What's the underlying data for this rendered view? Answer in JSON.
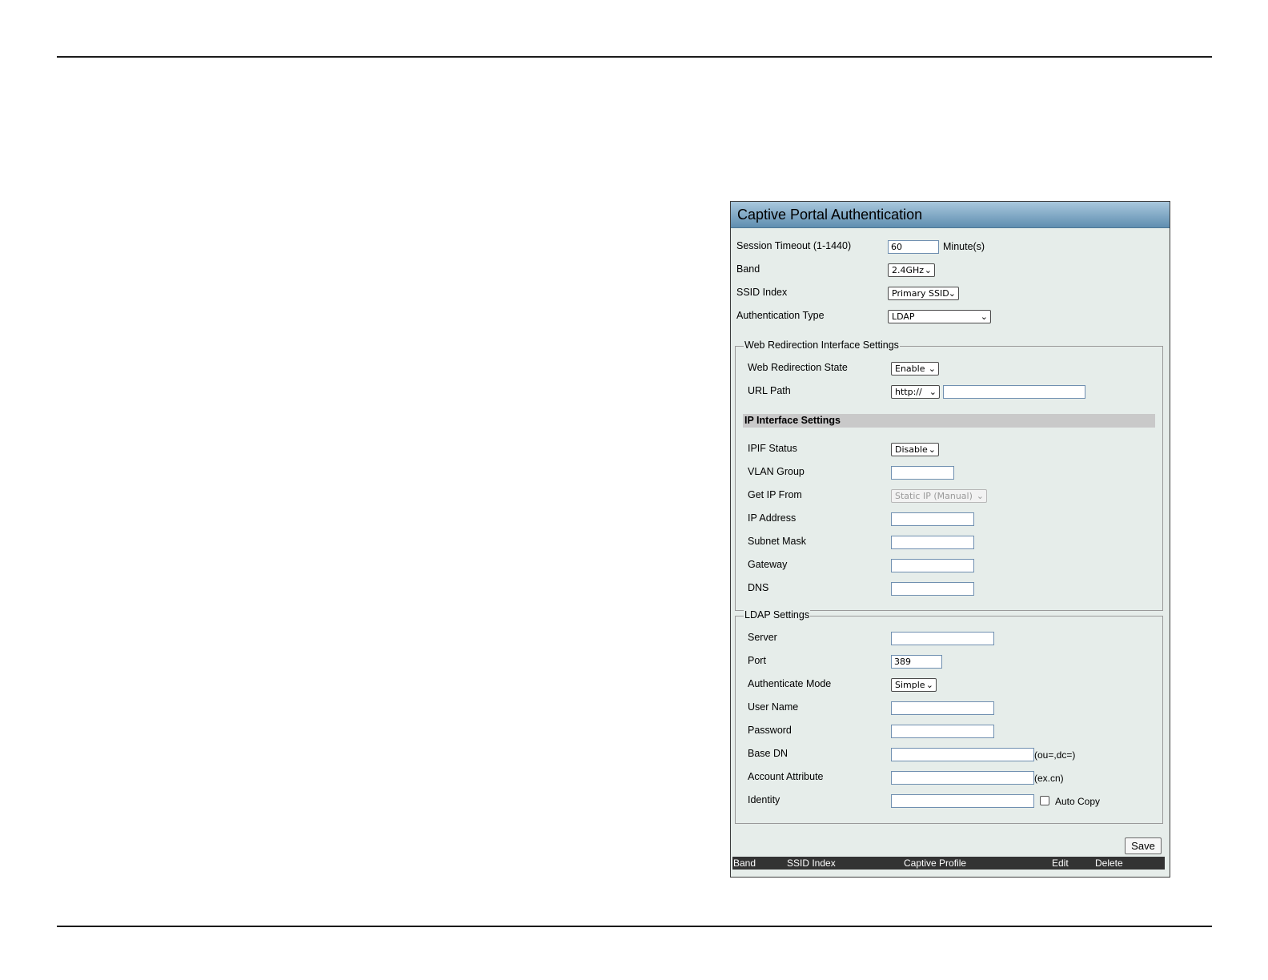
{
  "panel": {
    "title": "Captive Portal Authentication"
  },
  "general": {
    "session_timeout": {
      "label": "Session Timeout (1-1440)",
      "value": "60",
      "unit": "Minute(s)"
    },
    "band": {
      "label": "Band",
      "value": "2.4GHz"
    },
    "ssid_index": {
      "label": "SSID Index",
      "value": "Primary SSID"
    },
    "auth_type": {
      "label": "Authentication Type",
      "value": "LDAP"
    }
  },
  "web_redirection": {
    "legend": "Web Redirection Interface Settings",
    "state": {
      "label": "Web Redirection State",
      "value": "Enable"
    },
    "url_path": {
      "label": "URL Path",
      "protocol": "http://",
      "value": ""
    }
  },
  "ip_interface": {
    "title": "IP Interface Settings",
    "ipif_status": {
      "label": "IPIF Status",
      "value": "Disable"
    },
    "vlan_group": {
      "label": "VLAN Group",
      "value": ""
    },
    "get_ip_from": {
      "label": "Get IP From",
      "value": "Static IP (Manual)"
    },
    "ip_address": {
      "label": "IP Address",
      "value": ""
    },
    "subnet_mask": {
      "label": "Subnet Mask",
      "value": ""
    },
    "gateway": {
      "label": "Gateway",
      "value": ""
    },
    "dns": {
      "label": "DNS",
      "value": ""
    }
  },
  "ldap": {
    "legend": "LDAP Settings",
    "server": {
      "label": "Server",
      "value": ""
    },
    "port": {
      "label": "Port",
      "value": "389"
    },
    "auth_mode": {
      "label": "Authenticate Mode",
      "value": "Simple"
    },
    "user_name": {
      "label": "User Name",
      "value": ""
    },
    "password": {
      "label": "Password",
      "value": ""
    },
    "base_dn": {
      "label": "Base DN",
      "value": "",
      "hint": "(ou=,dc=)"
    },
    "account_attribute": {
      "label": "Account Attribute",
      "value": "",
      "hint": "(ex.cn)"
    },
    "identity": {
      "label": "Identity",
      "value": "",
      "auto_copy_label": "Auto Copy",
      "auto_copy_checked": false
    }
  },
  "actions": {
    "save_label": "Save"
  },
  "table": {
    "columns": [
      "Band",
      "SSID Index",
      "Captive Profile",
      "Edit",
      "Delete"
    ]
  }
}
